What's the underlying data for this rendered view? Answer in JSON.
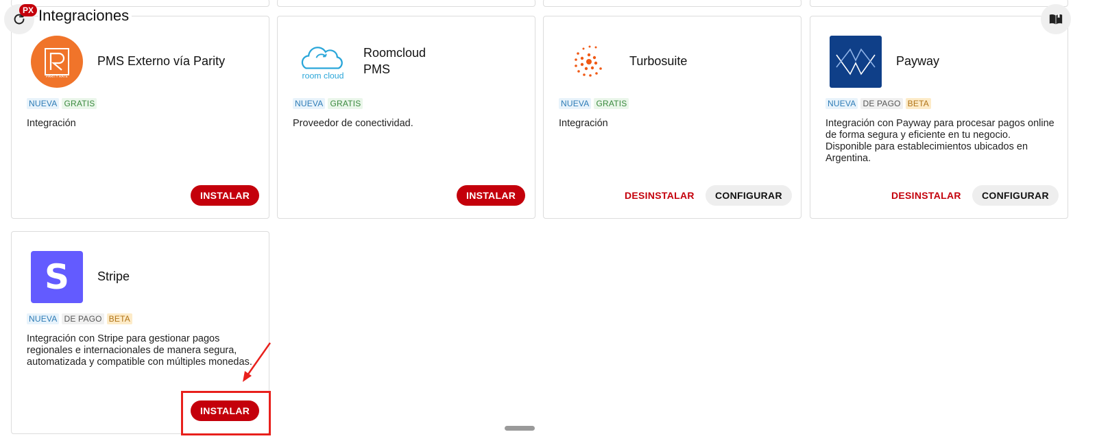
{
  "header": {
    "title": "Integraciones",
    "badge": "PX"
  },
  "icons": {
    "refresh": "refresh-icon",
    "book": "book-icon"
  },
  "badges": {
    "new": "NUEVA",
    "free": "GRATIS",
    "paid": "DE PAGO",
    "beta": "BETA"
  },
  "actions": {
    "install": "INSTALAR",
    "uninstall": "DESINSTALAR",
    "configure": "CONFIGURAR"
  },
  "colors": {
    "accent": "#c4000b",
    "parity": "#f0742a",
    "payway": "#0f3f88",
    "stripe": "#635bff",
    "turbosuite": "#f05a16",
    "roomcloud": "#2aa6d9"
  },
  "integrations": [
    {
      "name": "PMS Externo vía Parity",
      "logo_text": "PARITY RATE",
      "description": "Integración"
    },
    {
      "name": "Roomcloud PMS",
      "logo_text": "room cloud",
      "description": "Proveedor de conectividad."
    },
    {
      "name": "Turbosuite",
      "description": "Integración"
    },
    {
      "name": "Payway",
      "description": "Integración con Payway para procesar pagos online de forma segura y eficiente en tu negocio. Disponible para establecimientos ubicados en Argentina."
    },
    {
      "name": "Stripe",
      "logo_text": "S",
      "description": "Integración con Stripe para gestionar pagos regionales e internacionales de manera segura, automatizada y compatible con múltiples monedas."
    }
  ]
}
